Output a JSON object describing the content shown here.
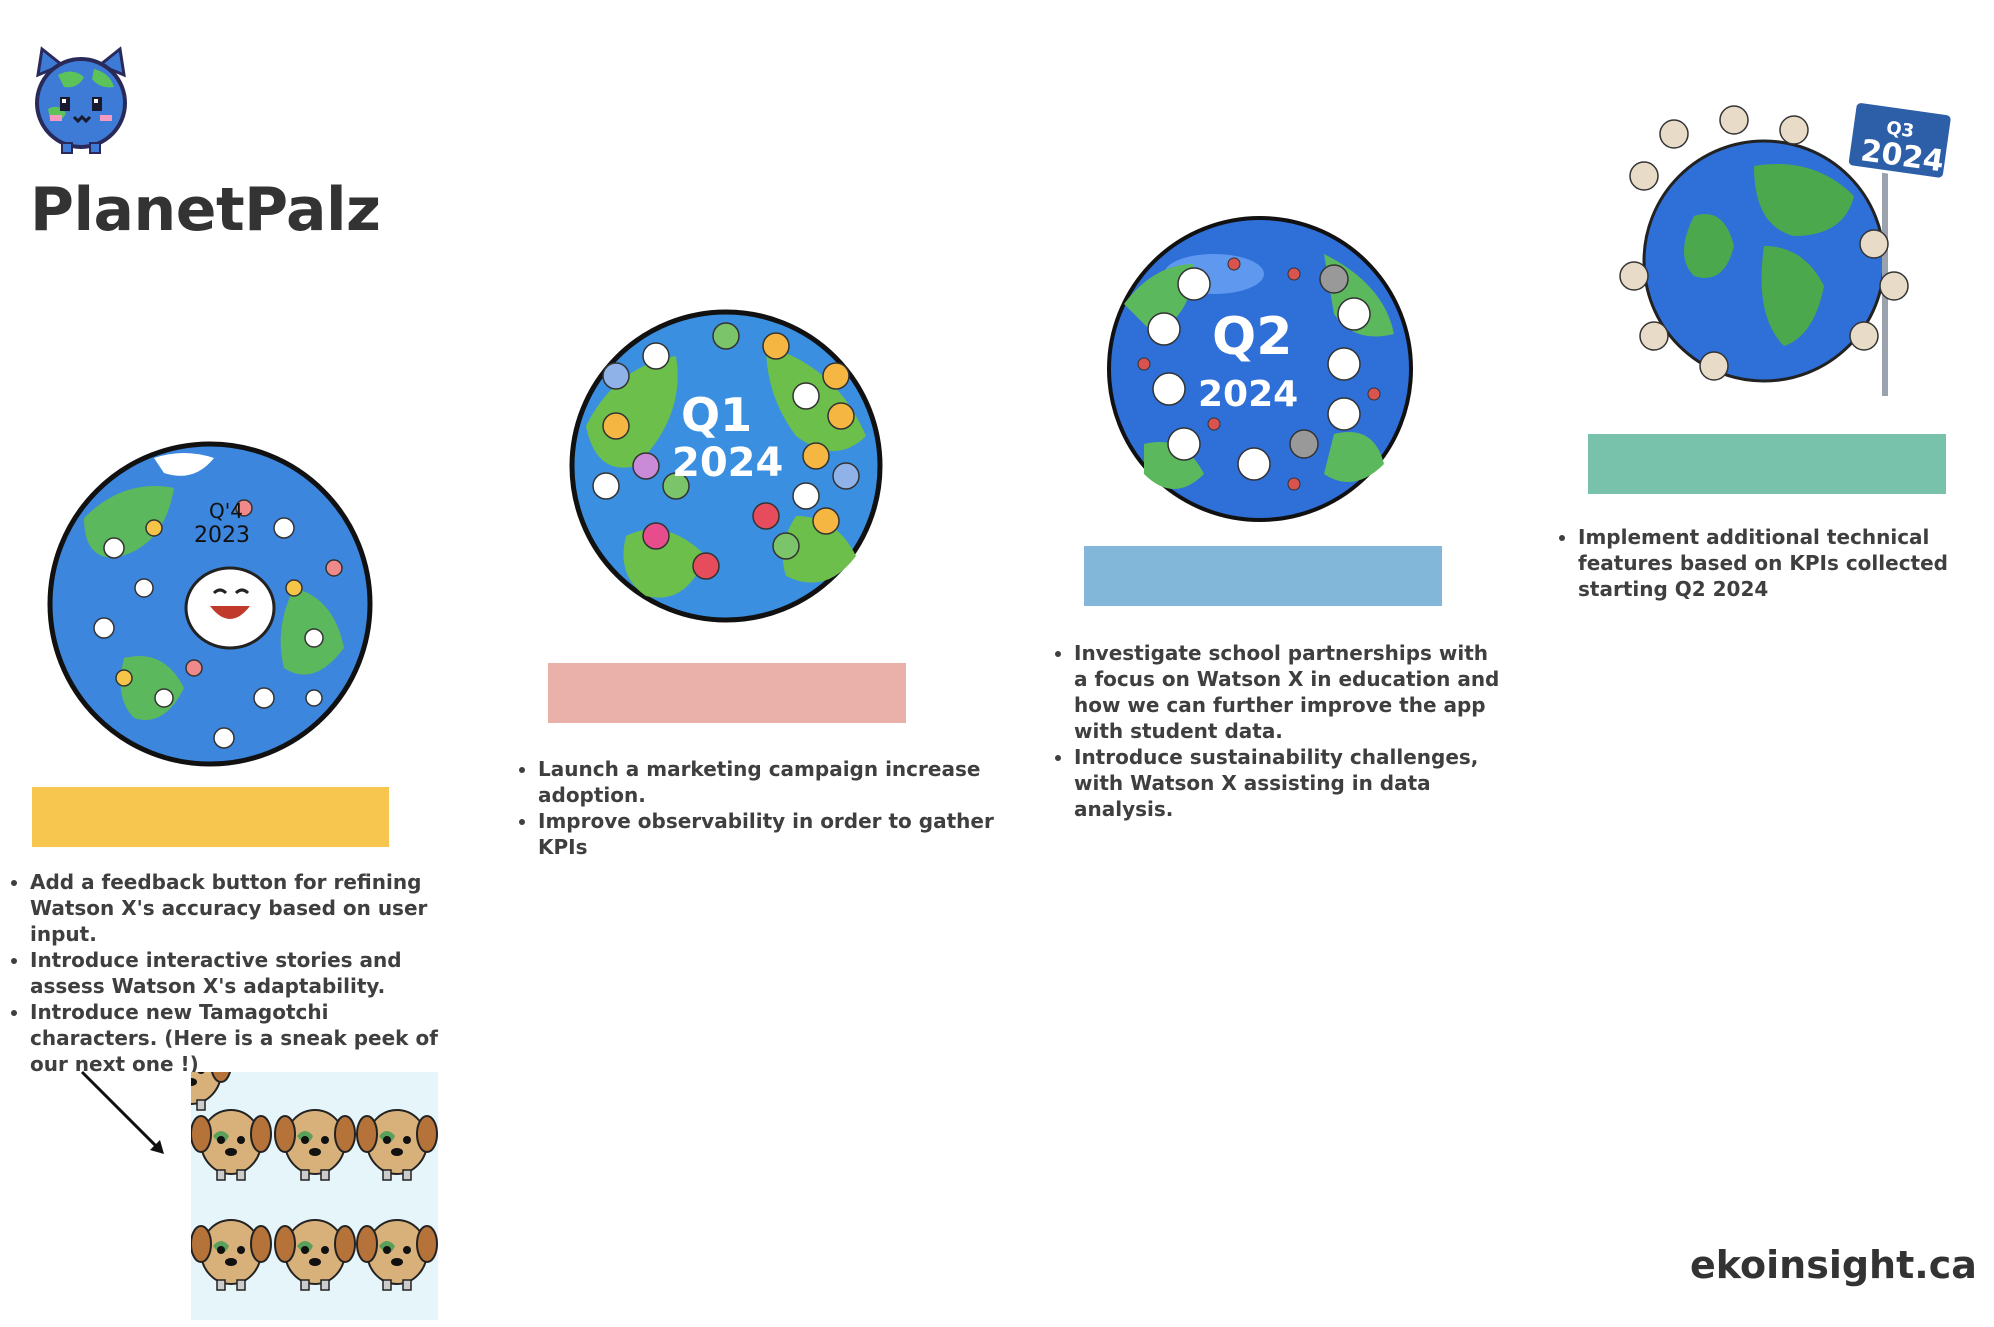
{
  "brand": {
    "name": "PlanetPalz",
    "website": "ekoinsight.ca"
  },
  "colors": {
    "q4_2023": "#f6c64f",
    "q1_2024": "#e9b1aa",
    "q2_2024": "#82b7da",
    "q3_2024": "#78c1ab"
  },
  "roadmap": {
    "q4_2023": {
      "globe_label_line1": "Q'4",
      "globe_label_line2": "2023",
      "items": [
        "Add a feedback button for refining Watson X's accuracy based on user input.",
        "Introduce interactive stories and assess Watson X's adaptability.",
        "Introduce new Tamagotchi characters. (Here is a sneak peek of our next one !)"
      ]
    },
    "q1_2024": {
      "globe_label_line1": "Q1",
      "globe_label_line2": "2024",
      "items": [
        "Launch a marketing campaign increase adoption.",
        "Improve observability in order to gather KPIs"
      ]
    },
    "q2_2024": {
      "globe_label_line1": "Q2",
      "globe_label_line2": "2024",
      "items": [
        "Investigate school partnerships with a focus on Watson X in education and how we can further improve the app with student data.",
        "Introduce sustainability challenges, with Watson X assisting in data analysis."
      ]
    },
    "q3_2024": {
      "sign_line1": "Q3",
      "sign_line2": "2024",
      "items": [
        "Implement additional technical features based on KPIs collected starting Q2 2024"
      ]
    }
  }
}
